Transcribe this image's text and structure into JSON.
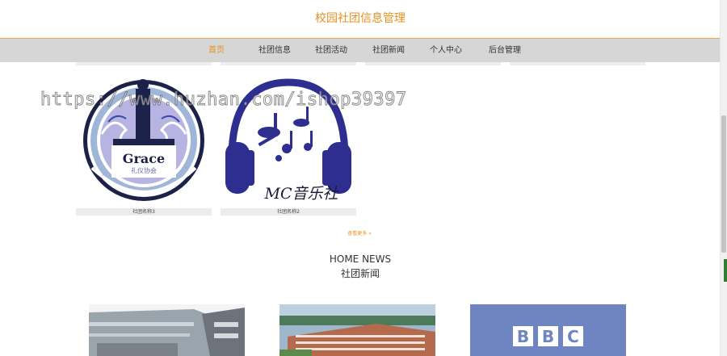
{
  "header": {
    "title": "校园社团信息管理"
  },
  "nav": {
    "items": [
      {
        "label": "首页",
        "active": true
      },
      {
        "label": "社团信息",
        "active": false
      },
      {
        "label": "社团活动",
        "active": false
      },
      {
        "label": "社团新闻",
        "active": false
      },
      {
        "label": "个人中心",
        "active": false
      },
      {
        "label": "后台管理",
        "active": false
      }
    ]
  },
  "clubs": [
    {
      "name": "社团名称3",
      "logo_text": "Grace",
      "logo_subtext": "礼仪协会"
    },
    {
      "name": "社团名称2",
      "logo_text": "MC音乐社"
    }
  ],
  "more_label": "查看更多 »",
  "news_section": {
    "title_en": "HOME NEWS",
    "title_cn": "社团新闻"
  },
  "news_thumbs": [
    {
      "text": ""
    },
    {
      "text": ""
    },
    {
      "text": "BBC"
    }
  ],
  "watermark": "https://www.huzhan.com/ishop39397",
  "colors": {
    "accent": "#e8901e",
    "navbar": "#d6d6d6"
  }
}
